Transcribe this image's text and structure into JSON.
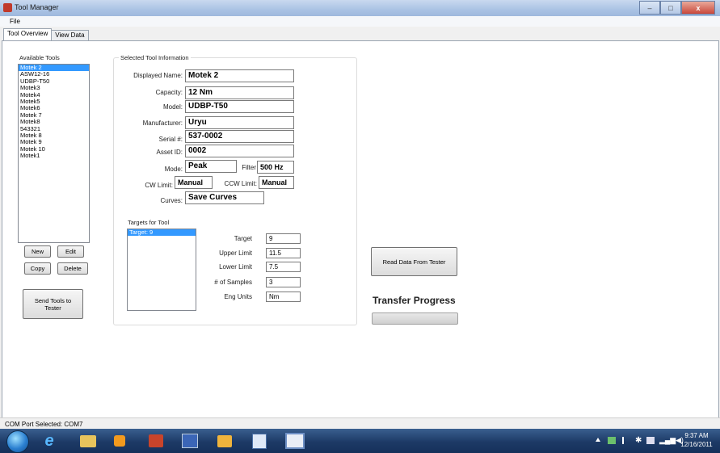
{
  "window": {
    "title": "Tool Manager",
    "minimize": "–",
    "maximize": "□",
    "close": "x"
  },
  "menu": {
    "file": "File"
  },
  "tabs": [
    {
      "label": "Tool Overview"
    },
    {
      "label": "View Data"
    }
  ],
  "available_tools": {
    "label": "Available Tools",
    "items": [
      "Motek 2",
      "ASW12-16",
      "UDBP-T50",
      "Motek3",
      "Motek4",
      "Motek5",
      "Motek6",
      "Motek 7",
      "Motek8",
      "543321",
      "Motek 8",
      "Motek 9",
      "Motek 10",
      "Motek1"
    ],
    "selected_index": 0
  },
  "tool_buttons": {
    "new": "New",
    "edit": "Edit",
    "copy": "Copy",
    "delete": "Delete",
    "send": "Send Tools to Tester"
  },
  "selected_tool": {
    "group_label": "Selected Tool Information",
    "displayed_name": {
      "label": "Displayed Name:",
      "value": "Motek 2"
    },
    "capacity": {
      "label": "Capacity:",
      "value": "12 Nm"
    },
    "model": {
      "label": "Model:",
      "value": "UDBP-T50"
    },
    "manufacturer": {
      "label": "Manufacturer:",
      "value": "Uryu"
    },
    "serial": {
      "label": "Serial #:",
      "value": "537-0002"
    },
    "asset": {
      "label": "Asset ID:",
      "value": "0002"
    },
    "mode": {
      "label": "Mode:",
      "value": "Peak"
    },
    "filter": {
      "label": "Filter",
      "value": "500 Hz"
    },
    "cw_limit": {
      "label": "CW Limit:",
      "value": "Manual"
    },
    "ccw_limit": {
      "label": "CCW Limit:",
      "value": "Manual"
    },
    "curves": {
      "label": "Curves:",
      "value": "Save Curves"
    }
  },
  "targets": {
    "label": "Targets for Tool",
    "items": [
      "Target: 9"
    ],
    "target": {
      "label": "Target",
      "value": "9"
    },
    "upper": {
      "label": "Upper Limit",
      "value": "11.5"
    },
    "lower": {
      "label": "Lower Limit",
      "value": "7.5"
    },
    "samples": {
      "label": "# of Samples",
      "value": "3"
    },
    "units": {
      "label": "Eng Units",
      "value": "Nm"
    }
  },
  "read_data_button": "Read Data From Tester",
  "transfer": {
    "label": "Transfer Progress",
    "progress": 0
  },
  "status_bar": {
    "text": "COM Port Selected:  COM7"
  },
  "taskbar": {
    "icons": [
      "internet-explorer-icon",
      "file-explorer-icon",
      "media-player-icon",
      "app-icon",
      "visual-studio-icon",
      "folder-icon",
      "word-icon",
      "window-icon"
    ],
    "clock_time": "9:37 AM",
    "clock_date": "12/16/2011"
  }
}
